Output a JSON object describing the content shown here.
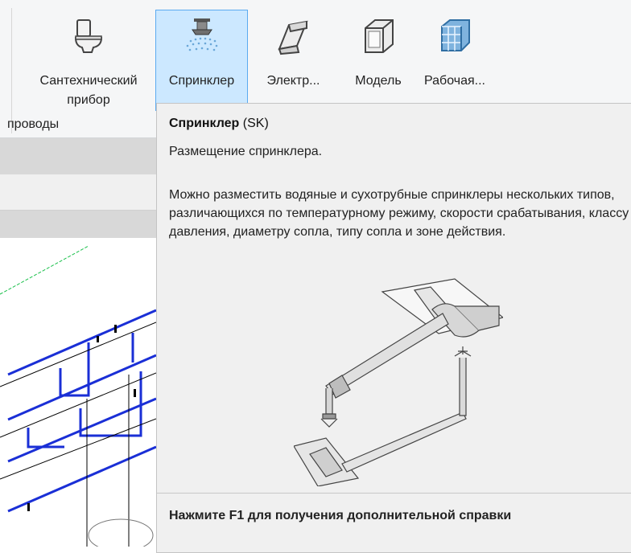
{
  "ribbon": {
    "buttons": [
      {
        "label": "Сантехнический\nприбор",
        "icon": "toilet-icon"
      },
      {
        "label": "Спринклер",
        "icon": "sprinkler-icon"
      },
      {
        "label": "Электр...",
        "icon": "electrical-fixture-icon"
      },
      {
        "label": "Модель",
        "icon": "model-box-icon"
      },
      {
        "label": "Рабочая...",
        "icon": "work-plane-grid-icon"
      }
    ],
    "panel_label": "проводы"
  },
  "tooltip": {
    "title": "Спринклер",
    "shortcut": "(SK)",
    "short_description": "Размещение спринклера.",
    "description": "Можно разместить водяные и сухотрубные спринклеры нескольких типов, различающихся по температурному режиму, скорости срабатывания, классу давления, диаметру сопла, типу сопла и зоне действия.",
    "help_hint": "Нажмите F1 для получения дополнительной справки"
  },
  "colors": {
    "active_button_bg": "#cce8ff",
    "active_button_border": "#5aaaf0",
    "pipe_blue": "#1a2fd6",
    "guide_green": "#19c04a"
  }
}
